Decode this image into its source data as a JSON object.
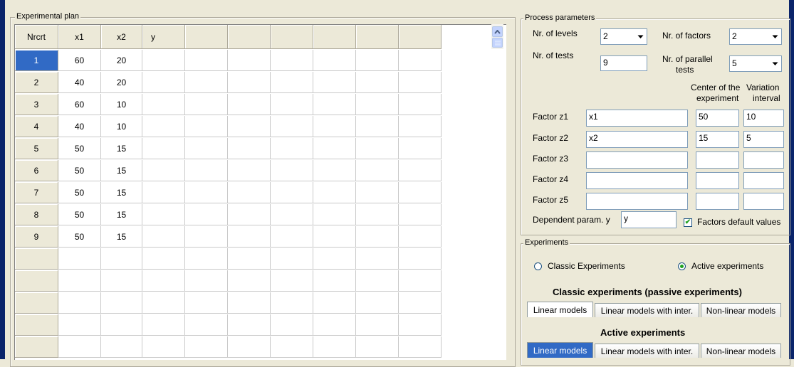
{
  "experimental_plan": {
    "legend": "Experimental plan",
    "columns": [
      "Nrcrt",
      "x1",
      "x2",
      "y",
      "",
      "",
      "",
      "",
      "",
      ""
    ],
    "rows": [
      [
        "1",
        "60",
        "20",
        ""
      ],
      [
        "2",
        "40",
        "20",
        ""
      ],
      [
        "3",
        "60",
        "10",
        ""
      ],
      [
        "4",
        "40",
        "10",
        ""
      ],
      [
        "5",
        "50",
        "15",
        ""
      ],
      [
        "6",
        "50",
        "15",
        ""
      ],
      [
        "7",
        "50",
        "15",
        ""
      ],
      [
        "8",
        "50",
        "15",
        ""
      ],
      [
        "9",
        "50",
        "15",
        ""
      ]
    ],
    "empty_rows": 5
  },
  "process": {
    "legend": "Process parameters",
    "levels_label": "Nr. of levels",
    "levels_value": "2",
    "factors_label": "Nr. of factors",
    "factors_value": "2",
    "tests_label": "Nr. of tests",
    "tests_value": "9",
    "parallel_label_1": "Nr. of parallel",
    "parallel_label_2": "tests",
    "parallel_value": "5",
    "center_label_1": "Center of the",
    "center_label_2": "experiment",
    "variation_label_1": "Variation",
    "variation_label_2": "interval",
    "factors": [
      {
        "label": "Factor z1",
        "name": "x1",
        "center": "50",
        "interval": "10"
      },
      {
        "label": "Factor z2",
        "name": "x2",
        "center": "15",
        "interval": "5"
      },
      {
        "label": "Factor z3",
        "name": "",
        "center": "",
        "interval": ""
      },
      {
        "label": "Factor z4",
        "name": "",
        "center": "",
        "interval": ""
      },
      {
        "label": "Factor z5",
        "name": "",
        "center": "",
        "interval": ""
      }
    ],
    "dependent_label": "Dependent param. y",
    "dependent_value": "y",
    "defaults_label": "Factors default values"
  },
  "experiments": {
    "legend": "Experiments",
    "classic_radio": "Classic Experiments",
    "active_radio": "Active experiments",
    "classic_title": "Classic experiments (passive experiments)",
    "active_title": "Active experiments",
    "tabs": [
      "Linear models",
      "Linear models with inter.",
      "Non-linear models"
    ]
  }
}
